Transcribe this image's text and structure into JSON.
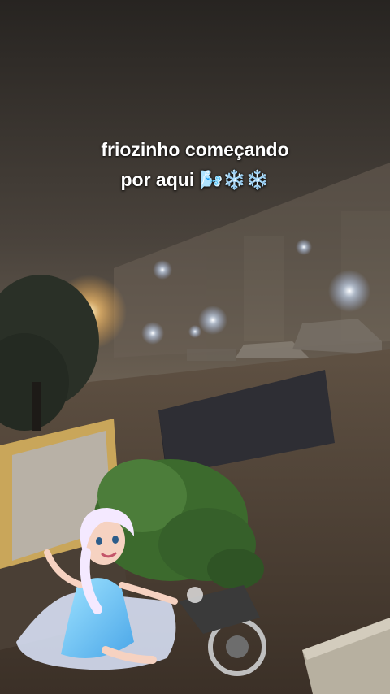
{
  "caption": {
    "line1": "friozinho começando",
    "line2": "por aqui 🌬️❄️❄️"
  },
  "colors": {
    "fog": "#6f6458",
    "sky": "#2e2a27",
    "street_light": "#ffd9a0",
    "building_light": "#cfe3ff",
    "tree": "#2f3a2a",
    "plant": "#4c7d3a"
  },
  "icons": [
    "wind-emoji-icon",
    "snowflake-emoji-icon",
    "snowflake-emoji-icon"
  ],
  "sticker": "elsa-frozen-sticker"
}
